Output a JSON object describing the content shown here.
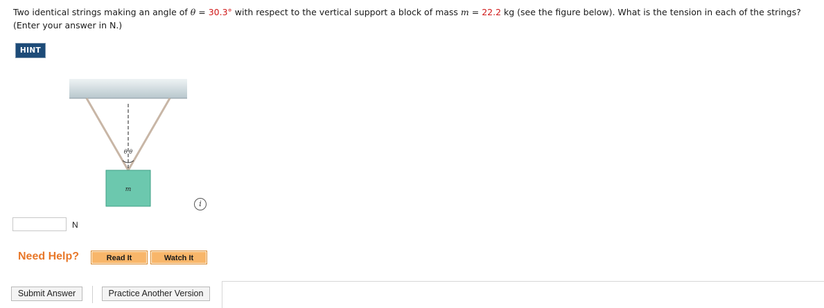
{
  "question": {
    "part1": "Two identical strings making an angle of ",
    "theta_symbol": "θ",
    "part2": " = ",
    "theta_value": "30.3°",
    "part3": " with respect to the vertical support a block of mass ",
    "m_symbol": "m",
    "part4": " = ",
    "m_value": "22.2",
    "part5": " kg (see the figure below). What is the tension in each of the strings? (Enter your answer in N.)"
  },
  "hint_label": "HINT",
  "figure": {
    "angle_label": "θ θ",
    "block_label": "m",
    "colors": {
      "ceiling": "#c9d6db",
      "block": "#6cc8ae",
      "block_border": "#3f9f86",
      "string": "#c8b6a6"
    }
  },
  "info_icon": "i",
  "answer": {
    "value": "",
    "unit": "N"
  },
  "need_help_label": "Need Help?",
  "buttons": {
    "read_it": "Read It",
    "watch_it": "Watch It",
    "submit": "Submit Answer",
    "practice": "Practice Another Version"
  }
}
